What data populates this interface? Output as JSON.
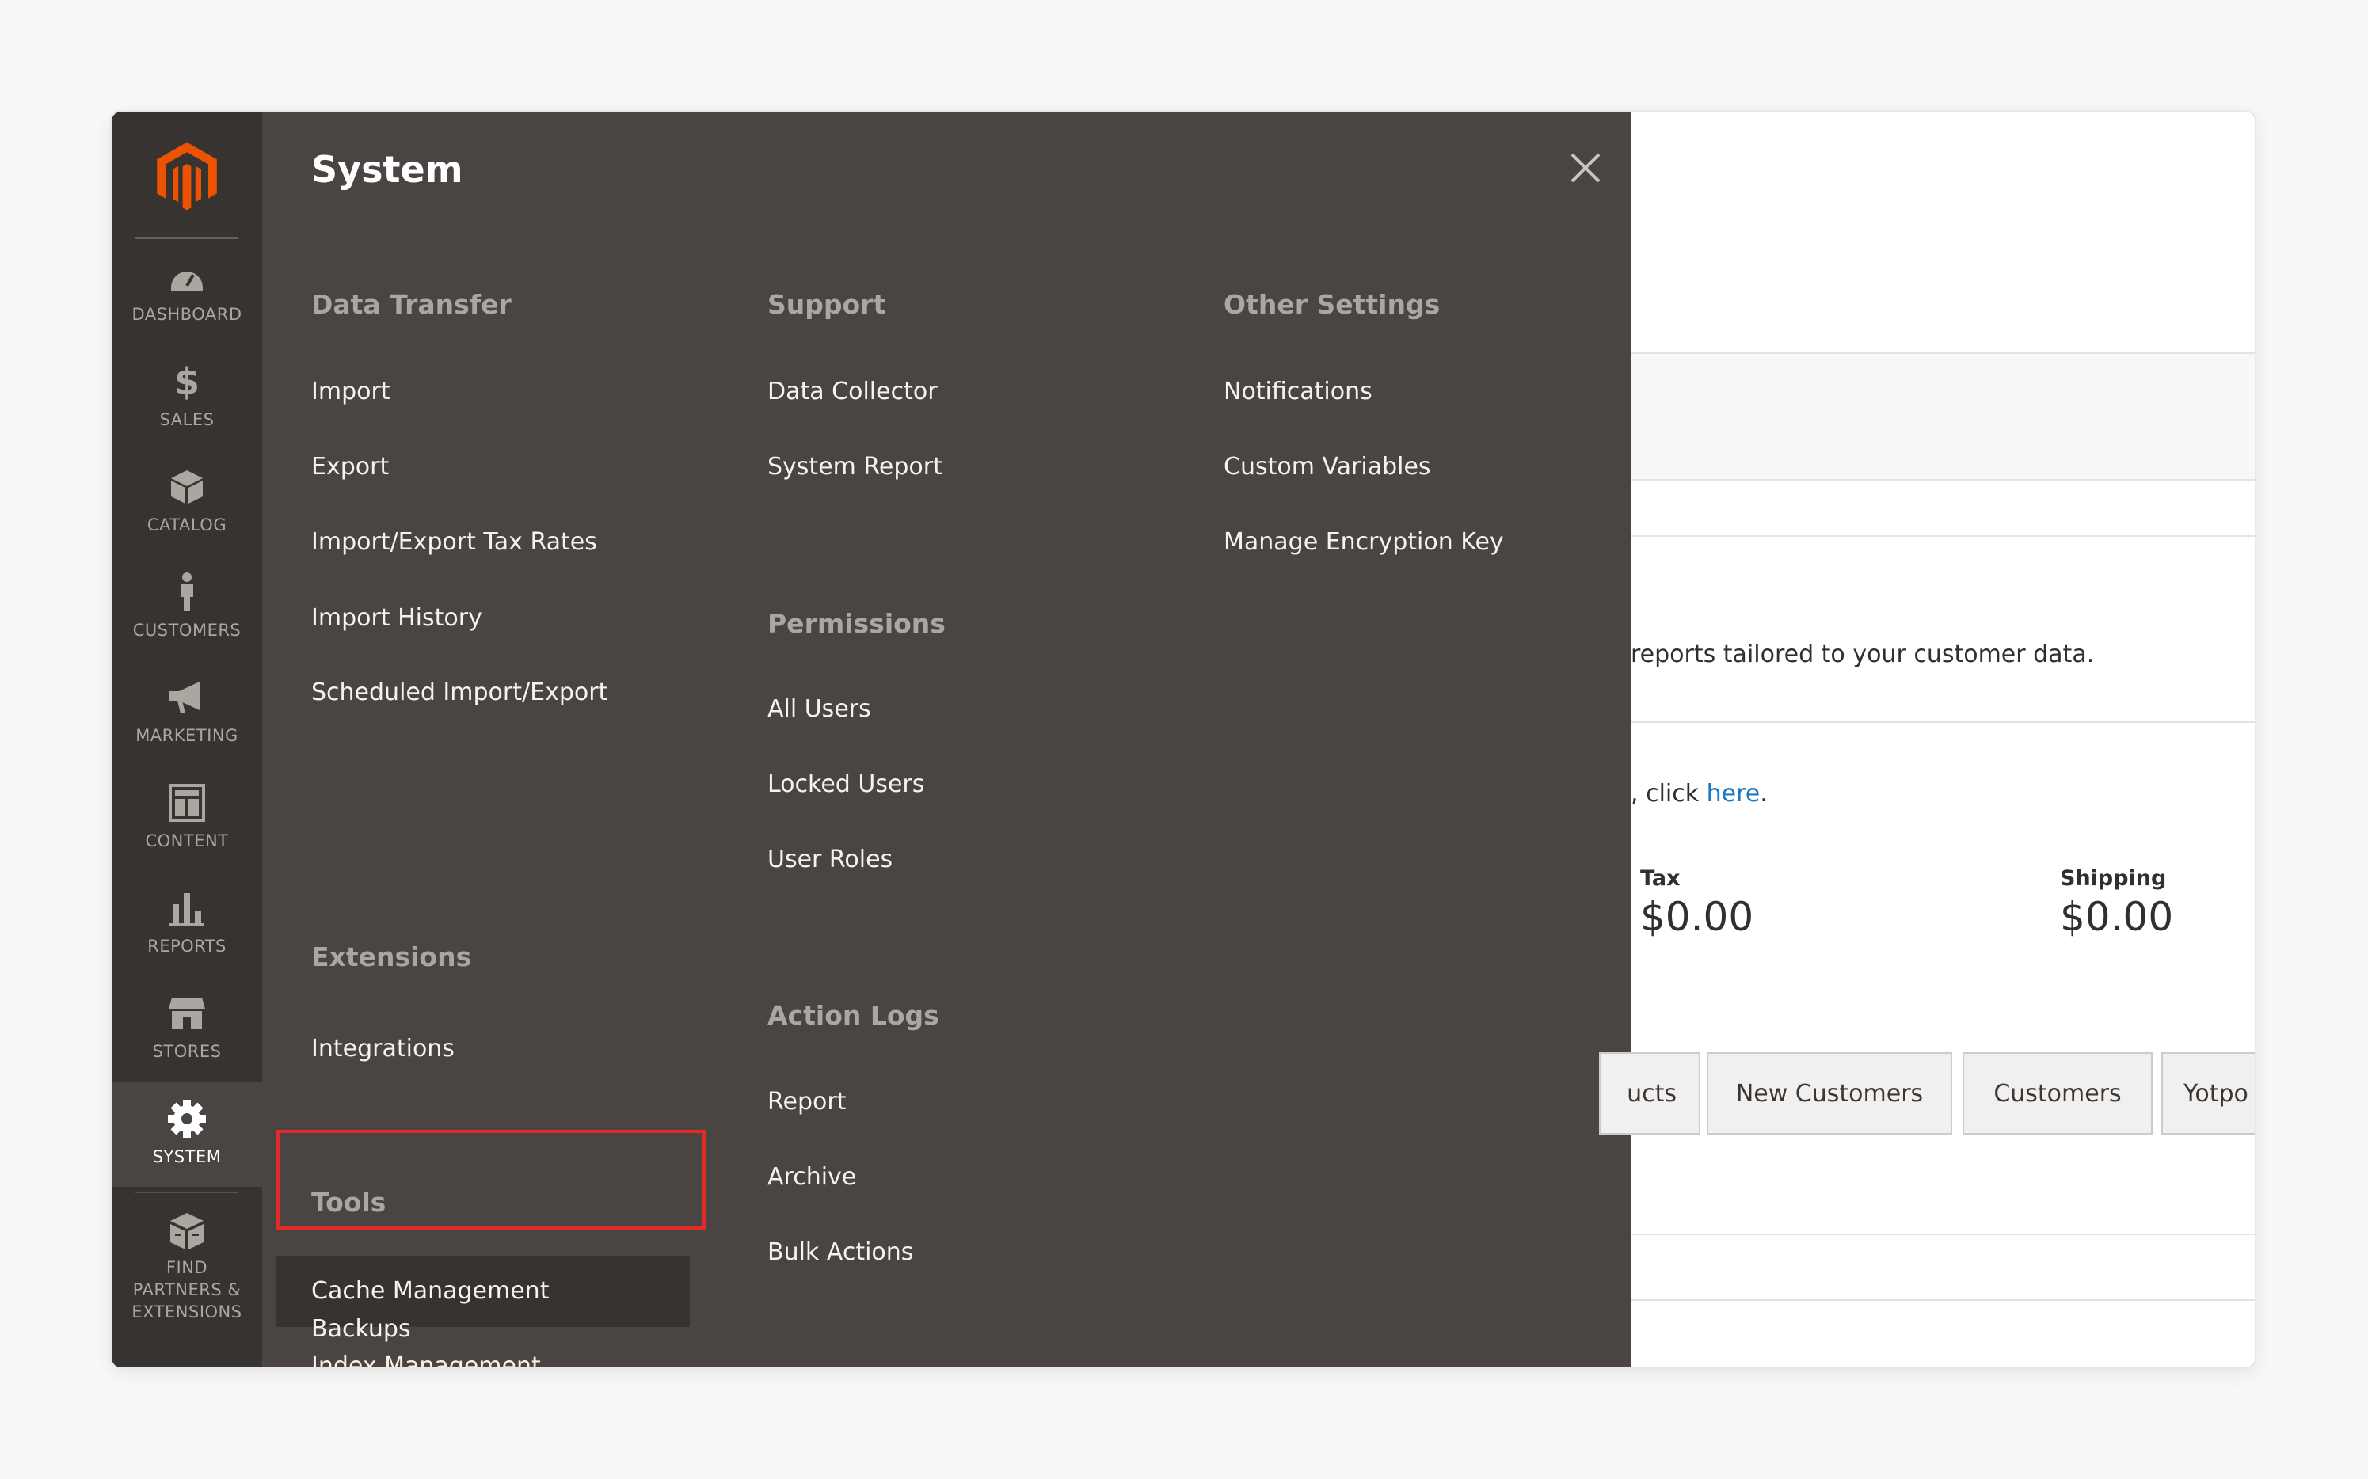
{
  "rail": {
    "items": [
      {
        "label": "DASHBOARD",
        "icon": "dashboard-icon"
      },
      {
        "label": "SALES",
        "icon": "dollar-icon"
      },
      {
        "label": "CATALOG",
        "icon": "box-icon"
      },
      {
        "label": "CUSTOMERS",
        "icon": "person-icon"
      },
      {
        "label": "MARKETING",
        "icon": "megaphone-icon"
      },
      {
        "label": "CONTENT",
        "icon": "layout-icon"
      },
      {
        "label": "REPORTS",
        "icon": "bar-chart-icon"
      },
      {
        "label": "STORES",
        "icon": "storefront-icon"
      },
      {
        "label": "SYSTEM",
        "icon": "gear-icon"
      },
      {
        "label": "FIND PARTNERS & EXTENSIONS",
        "icon": "partners-box-icon"
      }
    ],
    "active": "SYSTEM",
    "brand_color": "#eb5202"
  },
  "flyout": {
    "title": "System",
    "groups": {
      "data_transfer": {
        "title": "Data Transfer",
        "items": [
          "Import",
          "Export",
          "Import/Export Tax Rates",
          "Import History",
          "Scheduled Import/Export"
        ]
      },
      "extensions": {
        "title": "Extensions",
        "items": [
          "Integrations"
        ]
      },
      "tools": {
        "title": "Tools",
        "items": [
          "Cache Management",
          "Index Management",
          "Backups"
        ]
      },
      "support": {
        "title": "Support",
        "items": [
          "Data Collector",
          "System Report"
        ]
      },
      "permissions": {
        "title": "Permissions",
        "items": [
          "All Users",
          "Locked Users",
          "User Roles"
        ]
      },
      "action_logs": {
        "title": "Action Logs",
        "items": [
          "Report",
          "Archive",
          "Bulk Actions"
        ]
      },
      "other_settings": {
        "title": "Other Settings",
        "items": [
          "Notifications",
          "Custom Variables",
          "Manage Encryption Key"
        ]
      }
    },
    "highlighted_item": "Cache Management",
    "highlight_color": "#e02b27"
  },
  "background": {
    "reports_text": "reports tailored to your customer data.",
    "click_prefix": ", click ",
    "click_link": "here",
    "click_suffix": ".",
    "stats": [
      {
        "label": "Tax",
        "value": "$0.00"
      },
      {
        "label": "Shipping",
        "value": "$0.00"
      }
    ],
    "tabs": [
      "ucts",
      "New Customers",
      "Customers",
      "Yotpo"
    ]
  }
}
